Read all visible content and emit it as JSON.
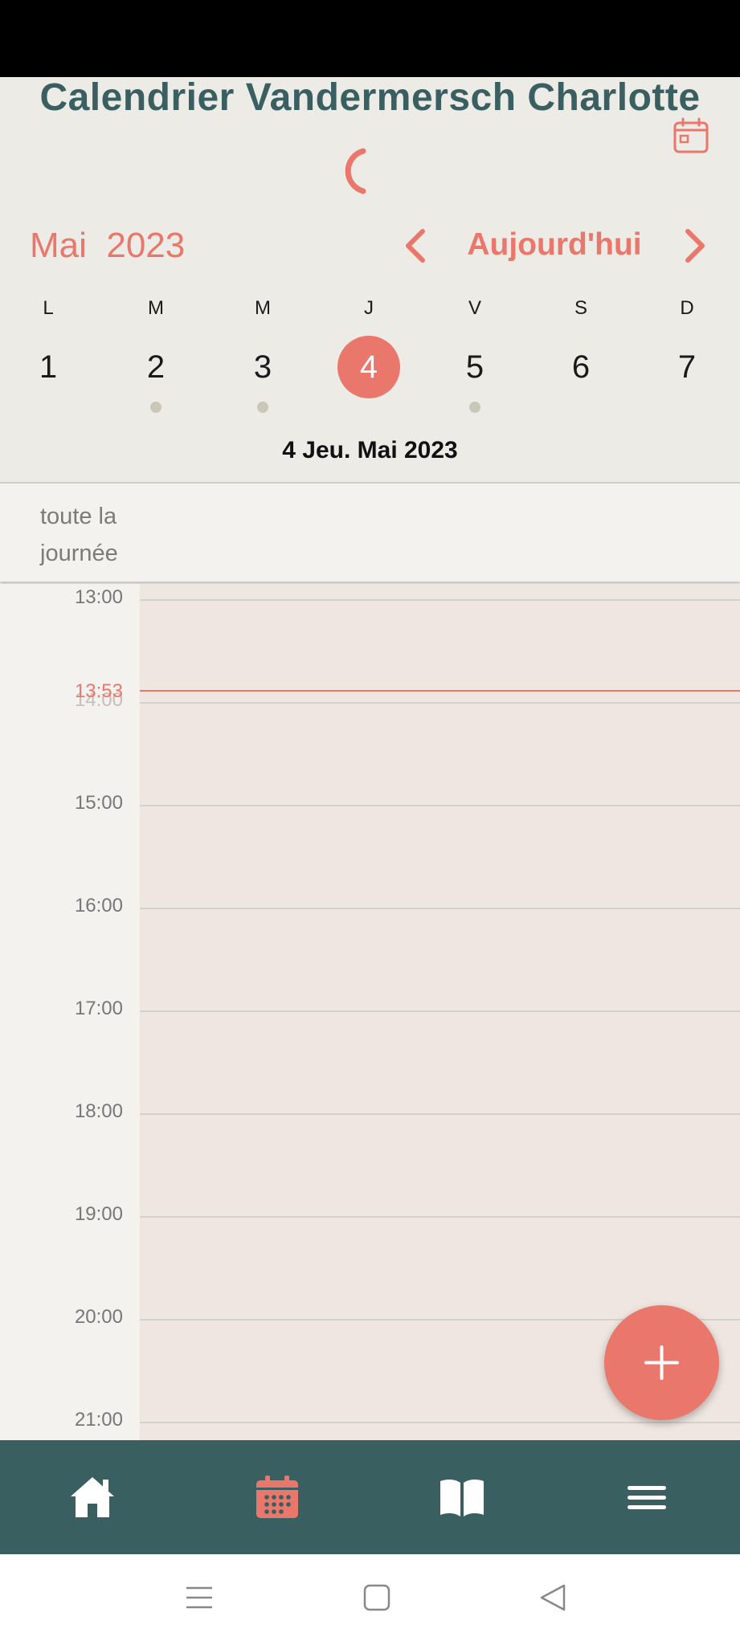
{
  "header": {
    "title": "Calendrier Vandermersch Charlotte",
    "month_label": "Mai  2023",
    "today_label": "Aujourd'hui",
    "selected_date": "4 Jeu. Mai 2023"
  },
  "week": {
    "weekdays": [
      "L",
      "M",
      "M",
      "J",
      "V",
      "S",
      "D"
    ],
    "days": [
      "1",
      "2",
      "3",
      "4",
      "5",
      "6",
      "7"
    ],
    "selected_index": 3,
    "days_with_events": [
      1,
      2,
      4
    ]
  },
  "allday_label": "toute la journée",
  "timeline": {
    "hours": [
      "13:00",
      "14:00",
      "15:00",
      "16:00",
      "17:00",
      "18:00",
      "19:00",
      "20:00",
      "21:00"
    ],
    "now": "13:53"
  },
  "bottom_nav": [
    "home-icon",
    "calendar-icon",
    "book-icon",
    "menu-icon"
  ],
  "colors": {
    "accent": "#e9776c",
    "primary": "#3a5f60",
    "header_bg": "#edebe6",
    "day_column_bg": "#efe5e1"
  }
}
